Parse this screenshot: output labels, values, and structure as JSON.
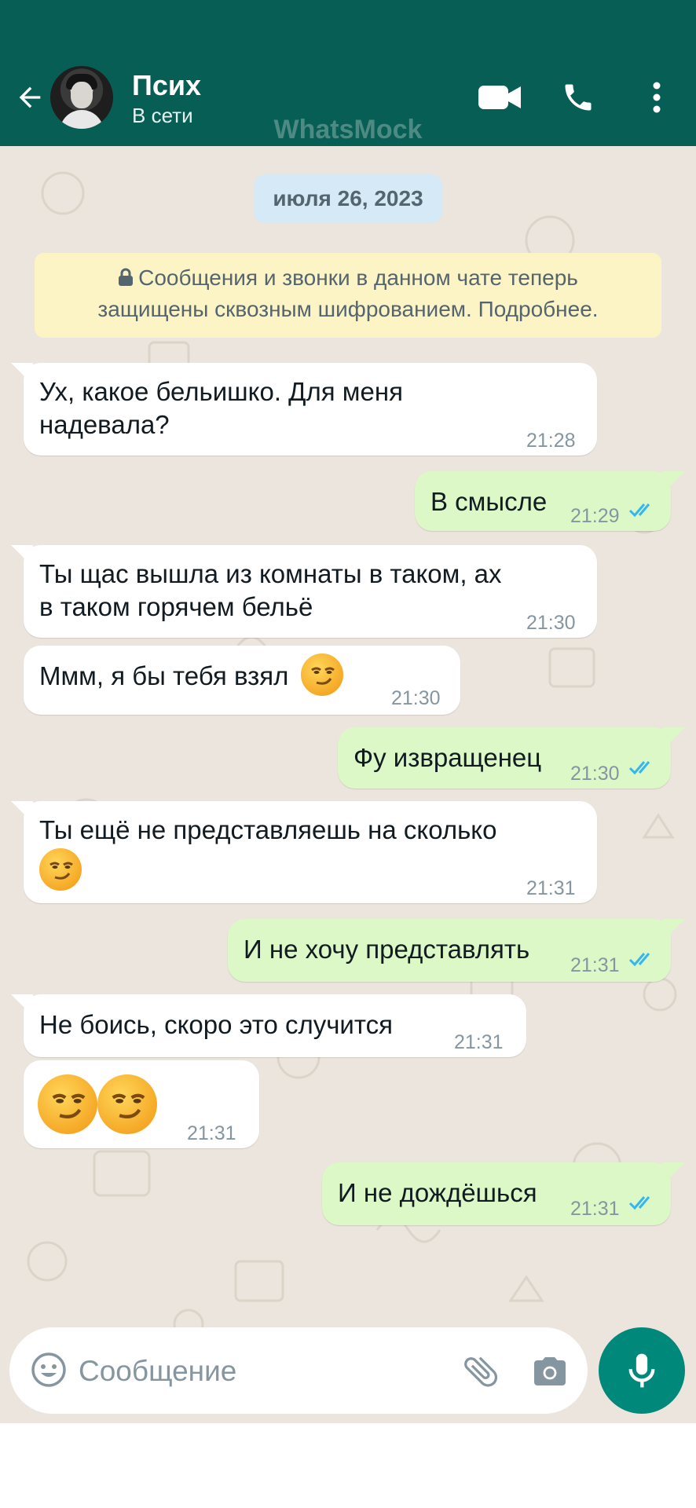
{
  "header": {
    "contact_name": "Псих",
    "status": "В сети",
    "watermark": "WhatsMock",
    "icons": [
      "back-arrow-icon",
      "video-call-icon",
      "voice-call-icon",
      "more-options-icon"
    ]
  },
  "chat": {
    "date": "июля 26, 2023",
    "encryption_notice_line1": "Сообщения и звонки в данном чате теперь",
    "encryption_notice_line2": "защищены сквозным шифрованием. Подробнее.",
    "messages": [
      {
        "direction": "incoming",
        "line1": "Ух, какое бельишко. Для меня",
        "line2": "надевала?",
        "time": "21:28"
      },
      {
        "direction": "outgoing",
        "text": "В смысле",
        "time": "21:29",
        "read": true
      },
      {
        "direction": "incoming",
        "line1": "Ты щас вышла из комнаты в таком, ах",
        "line2": "в таком горячем бельё",
        "time": "21:30"
      },
      {
        "direction": "incoming",
        "text": "Ммм, я бы тебя взял",
        "emoji": "smirking-face",
        "time": "21:30"
      },
      {
        "direction": "outgoing",
        "text": "Фу извращенец",
        "time": "21:30",
        "read": true
      },
      {
        "direction": "incoming",
        "line1": "Ты ещё не представляешь на сколько",
        "emoji": "smirking-face",
        "time": "21:31"
      },
      {
        "direction": "outgoing",
        "text": "И не хочу представлять",
        "time": "21:31",
        "read": true
      },
      {
        "direction": "incoming",
        "text": "Не боись, скоро это случится",
        "time": "21:31"
      },
      {
        "direction": "incoming",
        "emoji": "smirking-face x2",
        "time": "21:31"
      },
      {
        "direction": "outgoing",
        "text": "И не дождёшься",
        "time": "21:31",
        "read": true
      }
    ]
  },
  "composer": {
    "placeholder": "Сообщение",
    "icons": [
      "emoji-icon",
      "attach-icon",
      "camera-icon",
      "microphone-icon"
    ]
  },
  "colors": {
    "header": "#075E54",
    "chat_background": "#ece5dd",
    "incoming_bubble": "#ffffff",
    "outgoing_bubble": "#dcf8c6",
    "read_ticks": "#34b7f1",
    "mic_button": "#00897b"
  }
}
